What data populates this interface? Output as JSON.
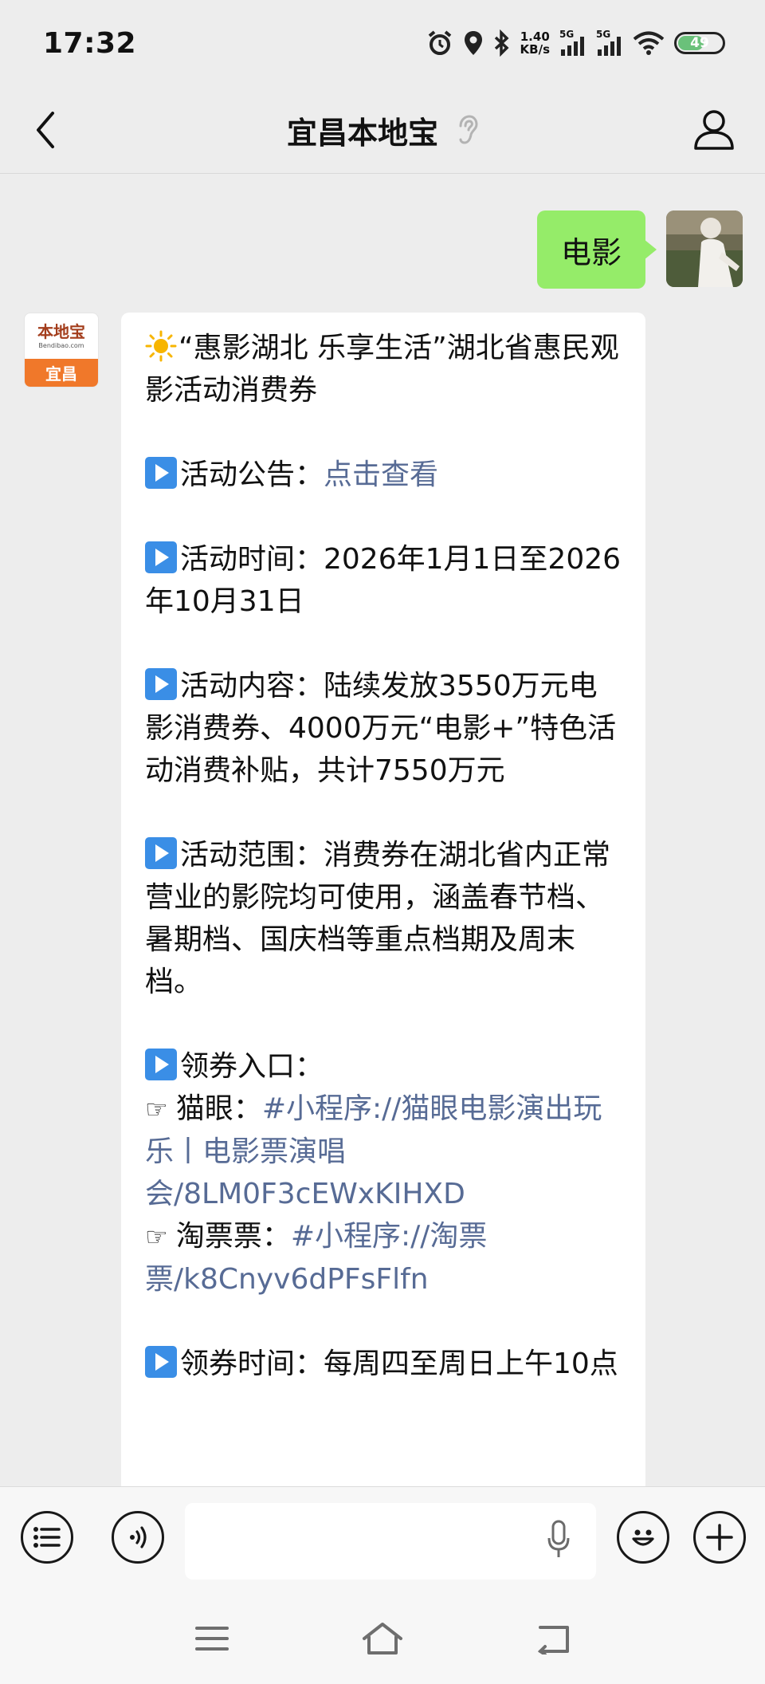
{
  "status_bar": {
    "time": "17:32",
    "net_speed_value": "1.40",
    "net_speed_unit": "KB/s",
    "signal1_label": "5G",
    "signal2_label": "5G",
    "battery_level": "49"
  },
  "header": {
    "title": "宜昌本地宝"
  },
  "chat": {
    "outgoing": {
      "text": "电影"
    },
    "incoming": {
      "avatar_name": "本地宝",
      "avatar_sub": "Bendibao.com",
      "avatar_city": "宜昌",
      "intro": "“惠影湖北 乐享生活”湖北省惠民观影活动消费券",
      "notice_label": "活动公告：",
      "notice_link": "点击查看",
      "time_text": "活动时间：2026年1月1日至2026年10月31日",
      "content_text": "活动内容：陆续发放3550万元电影消费券、4000万元“电影+”特色活动消费补贴，共计7550万元",
      "scope_text": "活动范围：消费券在湖北省内正常营业的影院均可使用，涵盖春节档、暑期档、国庆档等重点档期及周末档。",
      "entry_label": "领券入口：",
      "maoyan_label": "猫眼：",
      "maoyan_link": "#小程序://猫眼电影演出玩乐丨电影票演唱会/8LM0F3cEWxKIHXD",
      "taopiao_label": "淘票票：",
      "taopiao_link": "#小程序://淘票票/k8Cnyv6dPFsFlfn",
      "claim_time_text": "领券时间：每周四至周日上午10点"
    }
  },
  "input_bar": {
    "placeholder": ""
  },
  "icons": {
    "back": "chevron-left-icon",
    "ear": "ear-icon",
    "profile": "person-icon",
    "menu": "list-icon",
    "voice": "voice-icon",
    "mic": "microphone-icon",
    "emoji": "smiley-icon",
    "plus": "plus-icon"
  },
  "colors": {
    "outgoing_bubble": "#95ec69",
    "link": "#576b95",
    "play_icon": "#3a8ee6"
  }
}
